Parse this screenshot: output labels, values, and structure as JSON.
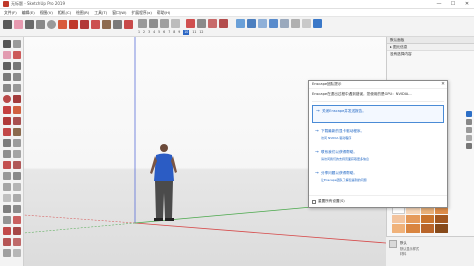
{
  "window": {
    "title": "无标题 - SketchUp Pro 2019",
    "minimize": "—",
    "maximize": "☐",
    "close": "✕"
  },
  "menu": [
    "文件(F)",
    "编辑(E)",
    "视图(V)",
    "相机(C)",
    "绘图(R)",
    "工具(T)",
    "窗口(W)",
    "扩展程序(x)",
    "帮助(H)"
  ],
  "toolbar": {
    "strip": [
      "1",
      "2",
      "3",
      "4",
      "5",
      "6",
      "7",
      "8",
      "9",
      "10",
      "11",
      "12"
    ],
    "strip_highlight": "10"
  },
  "tray": {
    "header": "默认面板",
    "section": "▸ 图元信息",
    "row": "没有选择内容"
  },
  "material": {
    "name": "默认",
    "label2": "默认显示样式",
    "label3": "材料"
  },
  "dialog": {
    "title": "Enscape团队提示",
    "message": "Enscape在退出过程中遇到错误，您使用的是GPU：NVIDIA...",
    "options": [
      {
        "main": "关闭Enscape并发送报告。",
        "sub": ""
      },
      {
        "main": "下载最新的显卡驱动程序。",
        "sub": "访问 NVIDIA 驱动程序"
      },
      {
        "main": "联系我们以获得帮助。",
        "sub": "请访问我们的支持页面获取更多信息"
      },
      {
        "main": "分享问题以获得帮助。",
        "sub": "让Enscape团队了解您遇到的问题"
      }
    ],
    "checkbox_label": "重置所有设置(S)"
  },
  "colors": {
    "accent": "#1c63c2",
    "red_axis": "#d64a4a",
    "green_axis": "#49a84a",
    "blue_axis": "#5a6fd8"
  }
}
